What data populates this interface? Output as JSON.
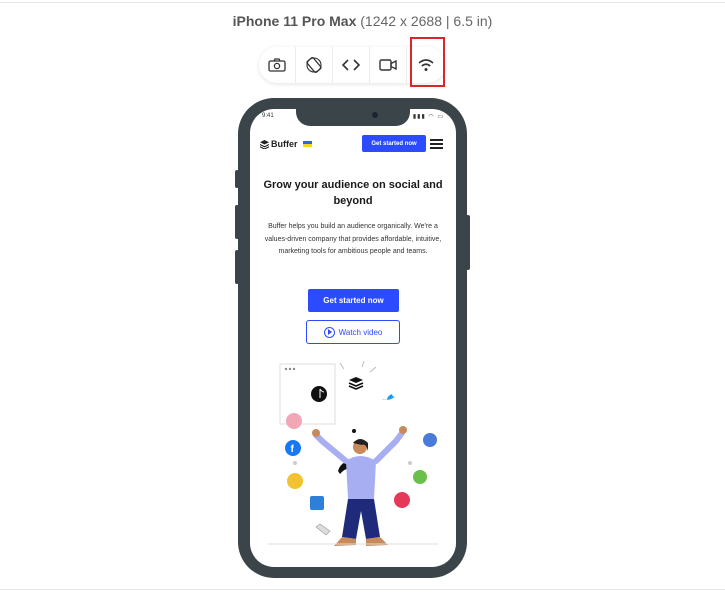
{
  "device": {
    "name": "iPhone 11 Pro Max",
    "specs": "(1242 x 2688 | 6.5 in)"
  },
  "toolbar": {
    "items": [
      {
        "icon": "camera-icon"
      },
      {
        "icon": "rotate-icon"
      },
      {
        "icon": "code-icon"
      },
      {
        "icon": "video-icon"
      },
      {
        "icon": "wifi-icon"
      }
    ]
  },
  "phone_screen": {
    "status_time": "9:41",
    "brand": "Buffer",
    "nav_cta": "Get started now",
    "hero_title": "Grow your audience on social and beyond",
    "hero_text": "Buffer helps you build an audience organically. We're a values-driven company that provides affordable, intuitive, marketing tools for ambitious people and teams.",
    "primary_cta": "Get started now",
    "secondary_cta": "Watch video"
  },
  "colors": {
    "accent": "#2c4bff",
    "highlight": "#d9262c",
    "phone_frame": "#3b4448"
  }
}
